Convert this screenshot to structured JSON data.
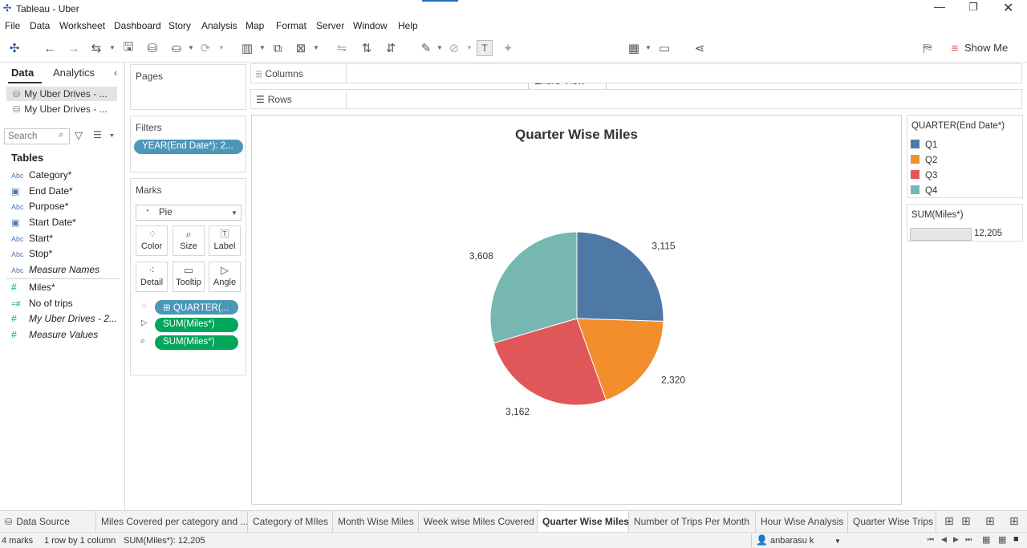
{
  "window": {
    "title": "Tableau - Uber"
  },
  "menu": [
    "File",
    "Data",
    "Worksheet",
    "Dashboard",
    "Story",
    "Analysis",
    "Map",
    "Format",
    "Server",
    "Window",
    "Help"
  ],
  "toolbar": {
    "view_select": "Entire View",
    "show_me": "Show Me"
  },
  "left_pane": {
    "tabs": [
      "Data",
      "Analytics"
    ],
    "datasources": [
      "My Uber Drives - ...",
      "My Uber Drives - ..."
    ],
    "search_placeholder": "Search",
    "tables_heading": "Tables",
    "dimensions": [
      {
        "icon": "Abc",
        "label": "Category*"
      },
      {
        "icon": "date",
        "label": "End Date*"
      },
      {
        "icon": "Abc",
        "label": "Purpose*"
      },
      {
        "icon": "date",
        "label": "Start Date*"
      },
      {
        "icon": "Abc",
        "label": "Start*"
      },
      {
        "icon": "Abc",
        "label": "Stop*"
      },
      {
        "icon": "Abc",
        "label": "Measure Names"
      }
    ],
    "measures": [
      {
        "icon": "#",
        "label": "Miles*"
      },
      {
        "icon": "=#",
        "label": "No of trips"
      },
      {
        "icon": "#",
        "label": "My Uber Drives - 2..."
      },
      {
        "icon": "#",
        "label": "Measure Values"
      }
    ]
  },
  "pages": {
    "title": "Pages"
  },
  "filters": {
    "title": "Filters",
    "pill": "YEAR(End Date*): 2..."
  },
  "marks": {
    "title": "Marks",
    "type": "Pie",
    "buttons": [
      "Color",
      "Size",
      "Label",
      "Detail",
      "Tooltip",
      "Angle"
    ],
    "pills": [
      "QUARTER(...",
      "SUM(Miles*)",
      "SUM(Miles*)"
    ]
  },
  "shelves": {
    "columns": "Columns",
    "rows": "Rows"
  },
  "chart_data": {
    "type": "pie",
    "title": "Quarter Wise Miles",
    "categories": [
      "Q1",
      "Q2",
      "Q3",
      "Q4"
    ],
    "values": [
      3115,
      2320,
      3162,
      3608
    ],
    "labels": [
      "3,115",
      "2,320",
      "3,162",
      "3,608"
    ],
    "colors": [
      "#4e79a7",
      "#f28e2b",
      "#e15759",
      "#76b7b2"
    ]
  },
  "legend": {
    "title": "QUARTER(End Date*)",
    "items": [
      "Q1",
      "Q2",
      "Q3",
      "Q4"
    ]
  },
  "size_legend": {
    "title": "SUM(Miles*)",
    "value": "12,205"
  },
  "sheet_tabs": [
    "Data Source",
    "Miles Covered per category and ...",
    "Category of MIles",
    "Month Wise Miles",
    "Week wise Miles Covered",
    "Quarter Wise Miles",
    "Number of Trips Per Month",
    "Hour Wise Analysis",
    "Quarter Wise Trips"
  ],
  "active_tab": "Quarter Wise Miles",
  "status": {
    "marks": "4 marks",
    "rows": "1 row by 1 column",
    "sum": "SUM(Miles*): 12,205",
    "user": "anbarasu k"
  }
}
